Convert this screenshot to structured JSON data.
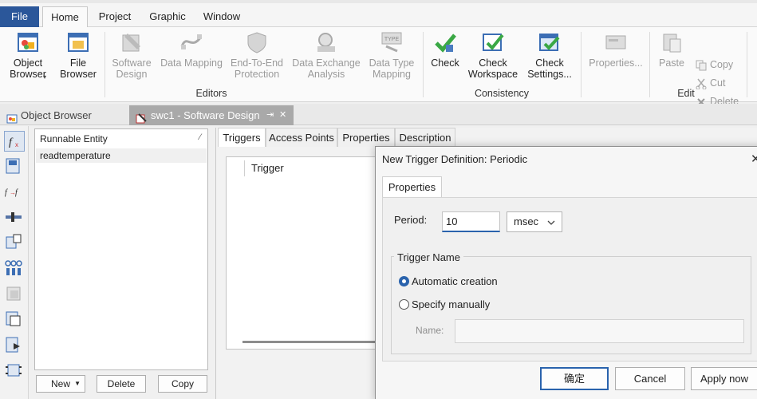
{
  "menubar": {
    "tabs": [
      "File",
      "Home",
      "Project",
      "Graphic",
      "Window"
    ],
    "active": "Home"
  },
  "ribbon": {
    "object_browser": "Object\nBrowser",
    "file_browser": "File\nBrowser",
    "software_design": "Software\nDesign",
    "data_mapping": "Data Mapping",
    "end_to_end": "End-To-End\nProtection",
    "data_exchange": "Data Exchange\nAnalysis",
    "data_type_mapping": "Data Type\nMapping",
    "check": "Check",
    "check_workspace": "Check\nWorkspace",
    "check_settings": "Check\nSettings...",
    "properties": "Properties...",
    "paste": "Paste",
    "copy": "Copy",
    "cut": "Cut",
    "delete": "Delete",
    "groups": {
      "editors": "Editors",
      "consistency": "Consistency",
      "edit": "Edit"
    },
    "type_badge": "TYPE"
  },
  "doc_tabs": {
    "object_browser": "Object Browser",
    "software_design": "swc1 - Software Design",
    "pin": "⇥",
    "close": "✕"
  },
  "runnable_panel": {
    "header": "Runnable Entity",
    "header_mark": "⁄",
    "rows": [
      "readtemperature"
    ],
    "buttons": {
      "new": "New",
      "new_arrow": "▼",
      "delete": "Delete",
      "copy": "Copy"
    }
  },
  "main_panel": {
    "tabs": [
      "Triggers",
      "Access Points",
      "Properties",
      "Description"
    ],
    "trigger_header": "Trigger"
  },
  "dialog": {
    "title": "New Trigger Definition: Periodic",
    "close": "✕",
    "tab": "Properties",
    "period_label": "Period:",
    "period_value": "10",
    "unit": "msec",
    "trigger_name_group": "Trigger Name",
    "auto_option": "Automatic creation",
    "manual_option": "Specify manually",
    "selected_option": "auto",
    "name_label": "Name:",
    "name_value": "",
    "ok": "确定",
    "cancel": "Cancel",
    "apply_now": "Apply now"
  },
  "colors": {
    "file_tab": "#2b579a",
    "accent": "#2a63ad",
    "active_doc_tab": "#a9a9a9"
  }
}
